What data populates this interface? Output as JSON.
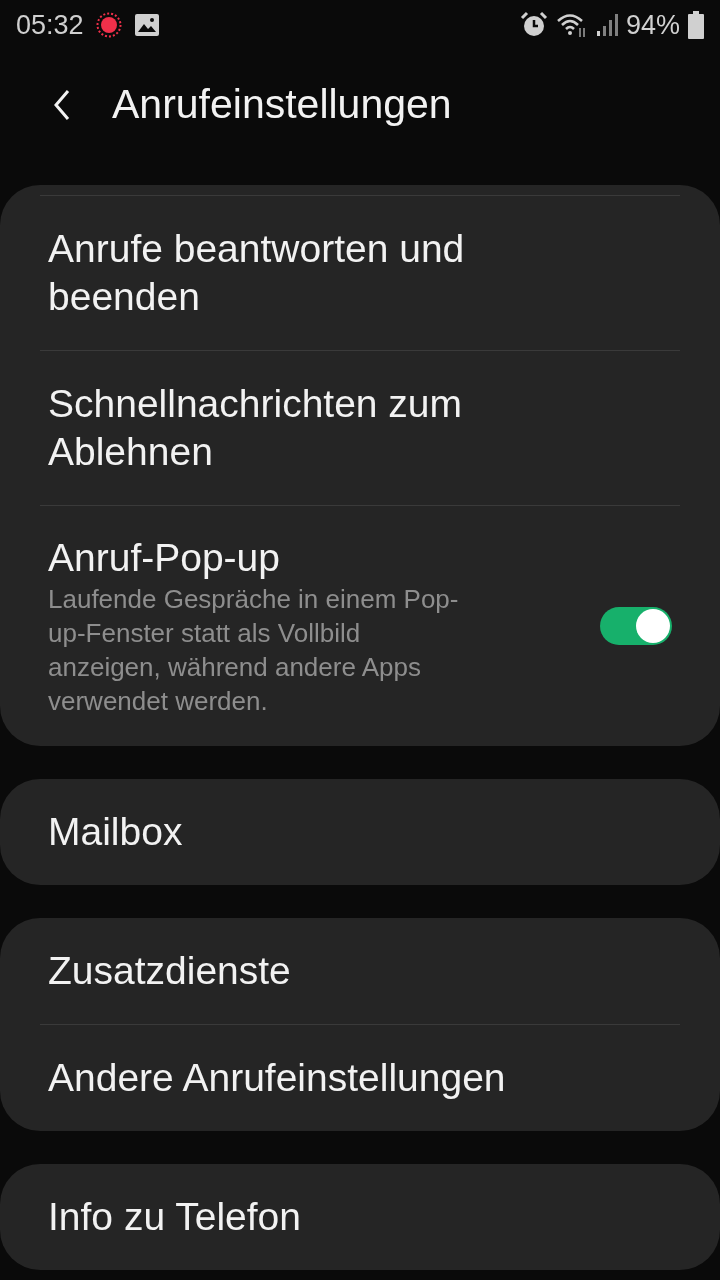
{
  "status_bar": {
    "time": "05:32",
    "battery": "94%"
  },
  "header": {
    "title": "Anrufeinstellungen"
  },
  "groups": [
    {
      "cut_top": true,
      "items": [
        {
          "kind": "text",
          "title": "Anrufe beantworten und beenden"
        },
        {
          "kind": "text",
          "title": "Schnellnachrichten zum Ablehnen"
        },
        {
          "kind": "switch",
          "title": "Anruf-Pop-up",
          "subtitle": "Laufende Gespräche in einem Pop-up-Fenster statt als Vollbild anzeigen, während andere Apps verwendet werden.",
          "on": true
        }
      ]
    },
    {
      "cut_top": false,
      "items": [
        {
          "kind": "text",
          "title": "Mailbox"
        }
      ]
    },
    {
      "cut_top": false,
      "items": [
        {
          "kind": "text",
          "title": "Zusatzdienste"
        },
        {
          "kind": "text",
          "title": "Andere Anrufeinstellungen"
        }
      ]
    },
    {
      "cut_top": false,
      "items": [
        {
          "kind": "text",
          "title": "Info zu Telefon"
        }
      ]
    }
  ]
}
